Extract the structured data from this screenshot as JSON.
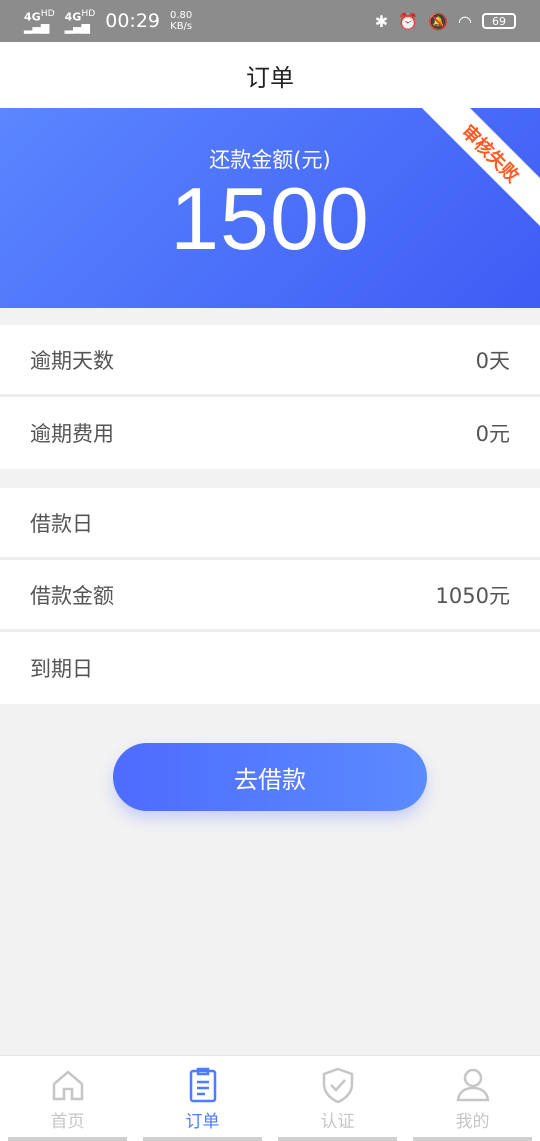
{
  "status": {
    "signal1": "4G",
    "signal1_sup": "HD",
    "signal2": "4G",
    "signal2_sup": "HD",
    "time": "00:29",
    "net_speed": "0.80",
    "net_unit": "KB/s",
    "battery": "69"
  },
  "title": "订单",
  "banner": {
    "label": "还款金额(元)",
    "amount": "1500",
    "ribbon": "审核失败"
  },
  "group1": [
    {
      "label": "逾期天数",
      "value": "0天"
    },
    {
      "label": "逾期费用",
      "value": "0元"
    }
  ],
  "group2": [
    {
      "label": "借款日",
      "value": ""
    },
    {
      "label": "借款金额",
      "value": "1050元"
    },
    {
      "label": "到期日",
      "value": ""
    }
  ],
  "cta_label": "去借款",
  "tabs": [
    {
      "label": "首页",
      "icon": "home-icon"
    },
    {
      "label": "订单",
      "icon": "clipboard-icon"
    },
    {
      "label": "认证",
      "icon": "shield-check-icon"
    },
    {
      "label": "我的",
      "icon": "person-icon"
    }
  ],
  "colors": {
    "accent": "#4d7cff",
    "ribbon_text": "#ff5a1f"
  }
}
